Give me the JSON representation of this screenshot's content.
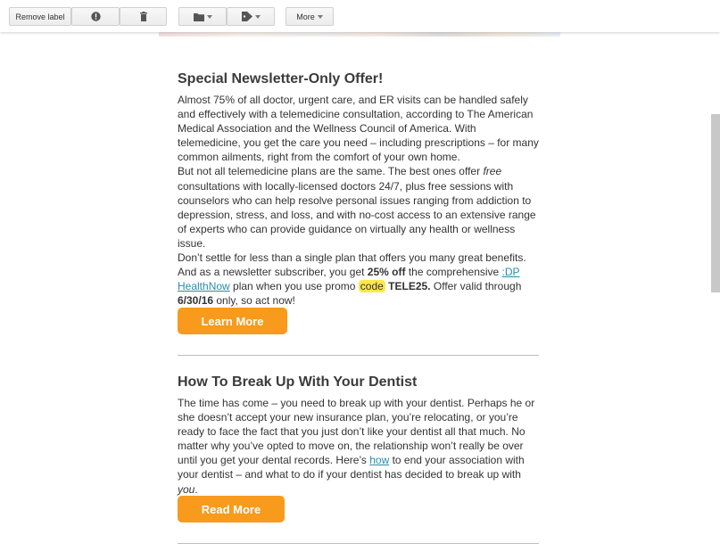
{
  "toolbar": {
    "remove_label": "Remove label",
    "more_label": "More"
  },
  "articles": [
    {
      "title": "Special Newsletter-Only Offer!",
      "p1": "Almost 75% of all doctor, urgent care, and ER visits can be handled safely and effectively with a telemedicine consultation, according to The American Medical Association and the Wellness Council of America. With telemedicine, you get the care you need – including prescriptions – for many common ailments, right from the comfort of your own home.",
      "p2_pre": "But not all telemedicine plans are the same. The best ones offer ",
      "p2_em": "free",
      "p2_post": " consultations with locally-licensed doctors 24/7, plus free sessions with counselors who can help resolve personal issues ranging from addiction to depression, stress, and loss, and with no-cost access to an extensive range of experts who can provide guidance on virtually any health or wellness issue.",
      "p3_a": "Don’t settle for less than a single plan that offers you many great benefits. And as a newsletter subscriber, you get ",
      "p3_bold": "25% off",
      "p3_b": " the comprehensive ",
      "p3_link": ":DP HealthNow",
      "p3_c": " plan when you use promo ",
      "p3_code": "code",
      "p3_d": " ",
      "p3_promo": "TELE25.",
      "p3_e": " Offer valid through ",
      "p3_date": "6/30/16",
      "p3_f": " only, so act now!",
      "button": "Learn More"
    },
    {
      "title": "How To Break Up With Your Dentist",
      "p1_a": "The time has come – you need to break up with your dentist. Perhaps he or she doesn’t accept your new insurance plan, you’re relocating, or you’re ready to face the fact that you just don’t like your dentist all that much. No matter why you’ve opted to move on, the relationship won’t really be over until you get your dental records. Here’s ",
      "p1_link": "how",
      "p1_b": " to end your association with your dentist – and what to do if your dentist has decided to break up with ",
      "p1_em": "you",
      "p1_c": ".",
      "button": "Read More"
    }
  ],
  "colors": {
    "button_orange": "#f89a1c",
    "link_teal": "#2a8ca8",
    "highlight_yellow": "#ffe84a"
  },
  "icons": [
    "report-spam-icon",
    "delete-icon",
    "folder-icon",
    "label-icon"
  ]
}
